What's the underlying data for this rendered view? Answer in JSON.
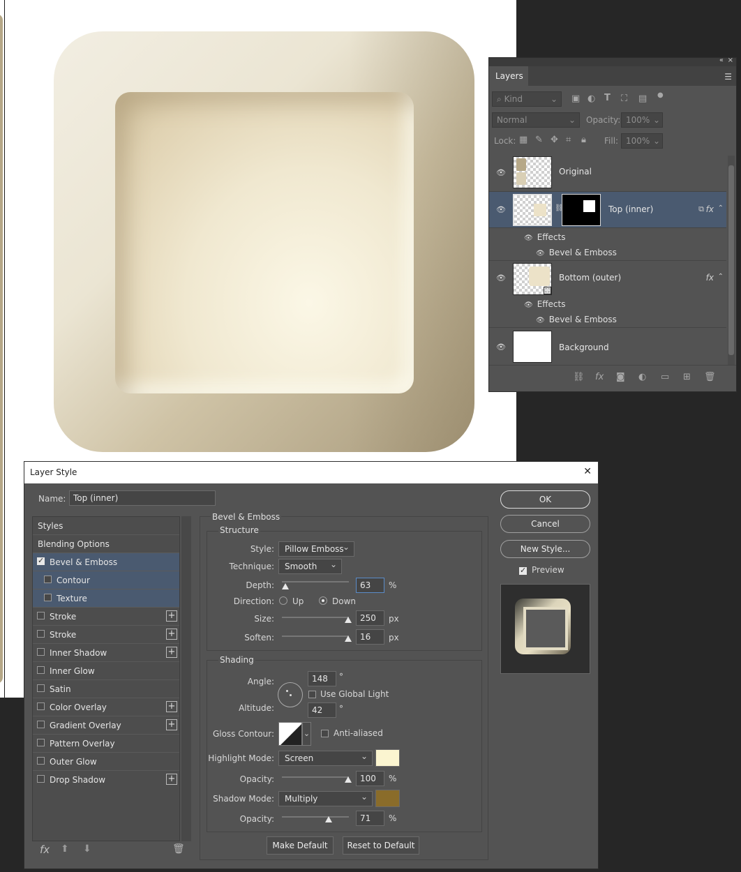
{
  "canvas": {
    "colors": {
      "outer_tile": "#a89a7c",
      "inner_tile": "#f0e8d0"
    }
  },
  "layers_panel": {
    "title": "Layers",
    "kind_filter": "Kind",
    "blend_mode": "Normal",
    "opacity_label": "Opacity:",
    "opacity_value": "100%",
    "lock_label": "Lock:",
    "fill_label": "Fill:",
    "fill_value": "100%",
    "layers": [
      {
        "name": "Original"
      },
      {
        "name": "Top (inner)",
        "effects_label": "Effects",
        "effect": "Bevel & Emboss"
      },
      {
        "name": "Bottom (outer)",
        "effects_label": "Effects",
        "effect": "Bevel & Emboss"
      },
      {
        "name": "Background"
      }
    ],
    "fx_label": "fx"
  },
  "dialog": {
    "title": "Layer Style",
    "name_label": "Name:",
    "name_value": "Top (inner)",
    "buttons": {
      "ok": "OK",
      "cancel": "Cancel",
      "new_style": "New Style...",
      "preview": "Preview"
    },
    "styles": [
      {
        "label": "Styles"
      },
      {
        "label": "Blending Options"
      },
      {
        "label": "Bevel & Emboss",
        "checked": true
      },
      {
        "label": "Contour",
        "checked": false
      },
      {
        "label": "Texture",
        "checked": false
      },
      {
        "label": "Stroke",
        "checked": false
      },
      {
        "label": "Stroke",
        "checked": false
      },
      {
        "label": "Inner Shadow",
        "checked": false
      },
      {
        "label": "Inner Glow",
        "checked": false
      },
      {
        "label": "Satin",
        "checked": false
      },
      {
        "label": "Color Overlay",
        "checked": false
      },
      {
        "label": "Gradient Overlay",
        "checked": false
      },
      {
        "label": "Pattern Overlay",
        "checked": false
      },
      {
        "label": "Outer Glow",
        "checked": false
      },
      {
        "label": "Drop Shadow",
        "checked": false
      }
    ],
    "list_footer": {
      "fx": "fx"
    },
    "bevel": {
      "section_title": "Bevel & Emboss",
      "structure_title": "Structure",
      "style_label": "Style:",
      "style_value": "Pillow Emboss",
      "technique_label": "Technique:",
      "technique_value": "Smooth",
      "depth_label": "Depth:",
      "depth_value": "63",
      "depth_unit": "%",
      "direction_label": "Direction:",
      "direction_up": "Up",
      "direction_down": "Down",
      "size_label": "Size:",
      "size_value": "250",
      "size_unit": "px",
      "soften_label": "Soften:",
      "soften_value": "16",
      "soften_unit": "px"
    },
    "shading": {
      "title": "Shading",
      "angle_label": "Angle:",
      "angle_value": "148",
      "degree": "°",
      "use_global_light": "Use Global Light",
      "altitude_label": "Altitude:",
      "altitude_value": "42",
      "gloss_contour_label": "Gloss Contour:",
      "anti_aliased": "Anti-aliased",
      "highlight_mode_label": "Highlight Mode:",
      "highlight_mode_value": "Screen",
      "highlight_color": "#fbf5d0",
      "highlight_opacity_label": "Opacity:",
      "highlight_opacity_value": "100",
      "shadow_mode_label": "Shadow Mode:",
      "shadow_mode_value": "Multiply",
      "shadow_color": "#8a6c2a",
      "shadow_opacity_label": "Opacity:",
      "shadow_opacity_value": "71",
      "percent": "%"
    },
    "make_default": "Make Default",
    "reset_to_default": "Reset to Default"
  }
}
